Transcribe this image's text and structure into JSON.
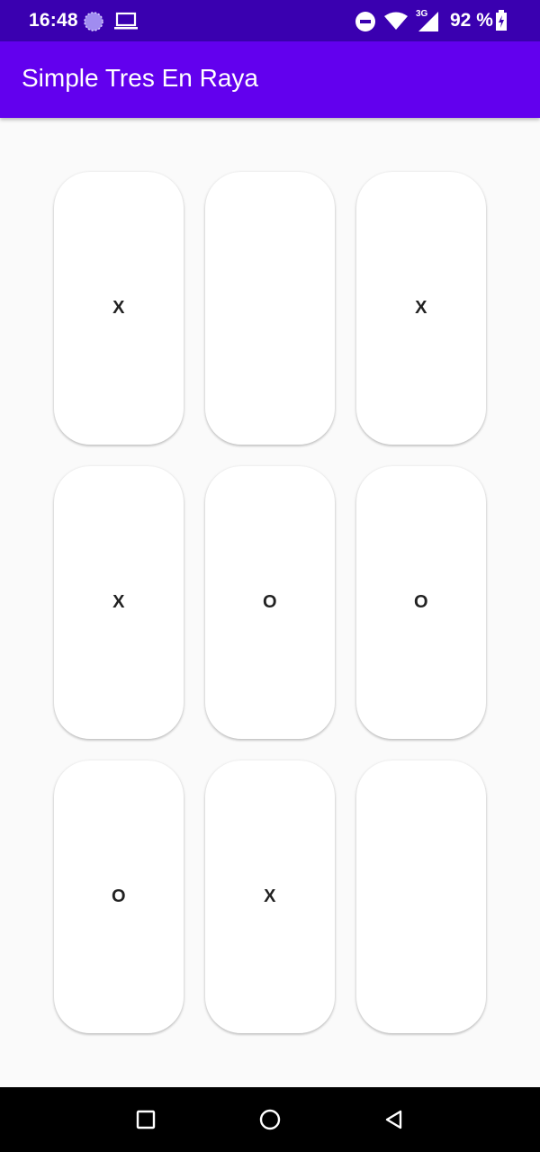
{
  "status_bar": {
    "time": "16:48",
    "battery": "92 %",
    "network": "3G",
    "icons": [
      "assistant-orb-icon",
      "laptop-icon",
      "do-not-disturb-icon",
      "wifi-icon",
      "mobile-signal-icon",
      "battery-charging-icon"
    ]
  },
  "app_bar": {
    "title": "Simple Tres En Raya",
    "color": "#6200ee",
    "status_color": "#3a00b0"
  },
  "board": {
    "cells": [
      "X",
      "",
      "X",
      "X",
      "O",
      "O",
      "O",
      "X",
      ""
    ]
  },
  "nav_bar": {
    "icons": [
      "recents-square-icon",
      "home-circle-icon",
      "back-triangle-icon"
    ]
  }
}
